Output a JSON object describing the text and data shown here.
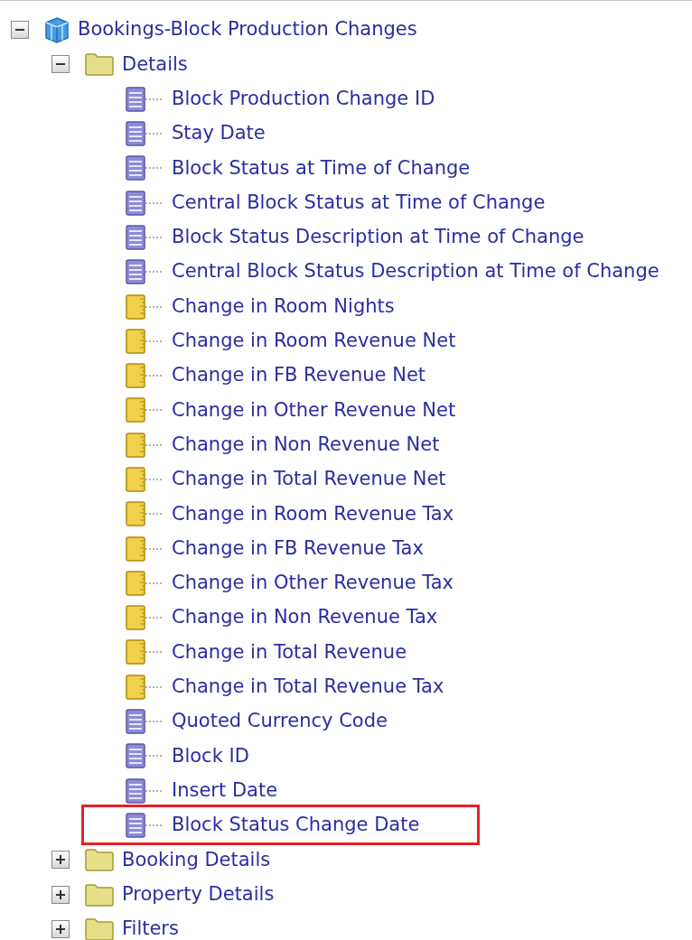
{
  "tree": [
    {
      "kind": "subject-area",
      "label": "Bookings-Block Production Changes",
      "expanded": true,
      "children": [
        {
          "kind": "folder",
          "label": "Details",
          "expanded": true,
          "children": [
            {
              "kind": "attribute",
              "label": "Block Production Change ID"
            },
            {
              "kind": "attribute",
              "label": "Stay Date"
            },
            {
              "kind": "attribute",
              "label": "Block Status at Time of Change"
            },
            {
              "kind": "attribute",
              "label": "Central Block Status at Time of Change"
            },
            {
              "kind": "attribute",
              "label": "Block Status Description at Time of Change"
            },
            {
              "kind": "attribute",
              "label": "Central Block Status Description at Time of Change"
            },
            {
              "kind": "measure",
              "label": "Change in Room Nights"
            },
            {
              "kind": "measure",
              "label": "Change in Room Revenue Net"
            },
            {
              "kind": "measure",
              "label": "Change in FB Revenue Net"
            },
            {
              "kind": "measure",
              "label": "Change in Other Revenue Net"
            },
            {
              "kind": "measure",
              "label": "Change in Non Revenue Net"
            },
            {
              "kind": "measure",
              "label": "Change in Total Revenue Net"
            },
            {
              "kind": "measure",
              "label": "Change in Room Revenue Tax"
            },
            {
              "kind": "measure",
              "label": "Change in FB Revenue Tax"
            },
            {
              "kind": "measure",
              "label": "Change in Other Revenue Tax"
            },
            {
              "kind": "measure",
              "label": "Change in Non Revenue Tax"
            },
            {
              "kind": "measure",
              "label": "Change in Total Revenue"
            },
            {
              "kind": "measure",
              "label": "Change in Total Revenue Tax"
            },
            {
              "kind": "attribute",
              "label": "Quoted Currency Code"
            },
            {
              "kind": "attribute",
              "label": "Block ID"
            },
            {
              "kind": "attribute",
              "label": "Insert Date"
            },
            {
              "kind": "attribute",
              "label": "Block Status Change Date",
              "highlighted": true
            }
          ]
        },
        {
          "kind": "folder",
          "label": "Booking Details",
          "expanded": false
        },
        {
          "kind": "folder",
          "label": "Property Details",
          "expanded": false
        },
        {
          "kind": "folder",
          "label": "Filters",
          "expanded": false
        }
      ]
    }
  ]
}
